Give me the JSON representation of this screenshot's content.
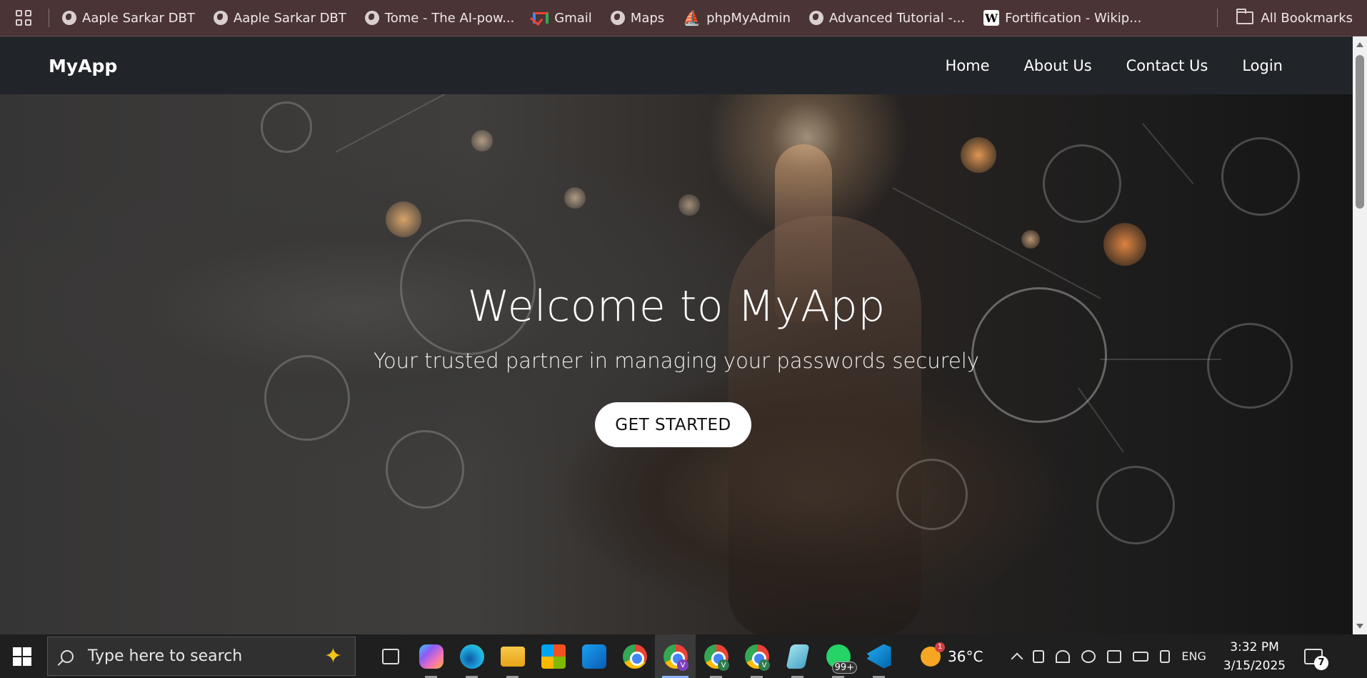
{
  "bookmarks": {
    "items": [
      {
        "label": "Aaple Sarkar DBT",
        "icon": "globe-icon"
      },
      {
        "label": "Aaple Sarkar DBT",
        "icon": "globe-icon"
      },
      {
        "label": "Tome - The AI-pow...",
        "icon": "globe-icon"
      },
      {
        "label": "Gmail",
        "icon": "gmail-icon"
      },
      {
        "label": "Maps",
        "icon": "globe-icon"
      },
      {
        "label": "phpMyAdmin",
        "icon": "phpmyadmin-icon"
      },
      {
        "label": "Advanced Tutorial -...",
        "icon": "globe-icon"
      },
      {
        "label": "Fortification - Wikip...",
        "icon": "wikipedia-icon"
      }
    ],
    "all_bookmarks": "All Bookmarks"
  },
  "navbar": {
    "brand": "MyApp",
    "links": [
      "Home",
      "About Us",
      "Contact Us",
      "Login"
    ]
  },
  "hero": {
    "title": "Welcome to MyApp",
    "subtitle": "Your trusted partner in managing your passwords securely",
    "cta": "GET STARTED"
  },
  "taskbar": {
    "search_placeholder": "Type here to search",
    "whatsapp_badge": "99+",
    "weather_temp": "36°C",
    "weather_badge": "1",
    "language": "ENG",
    "time": "3:32 PM",
    "date": "3/15/2025",
    "notifications": "7"
  },
  "colors": {
    "bookmarks_bg": "#4a3436",
    "navbar_bg": "#212529",
    "taskbar_bg": "#1f1f1f",
    "cta_bg": "#ffffff"
  }
}
